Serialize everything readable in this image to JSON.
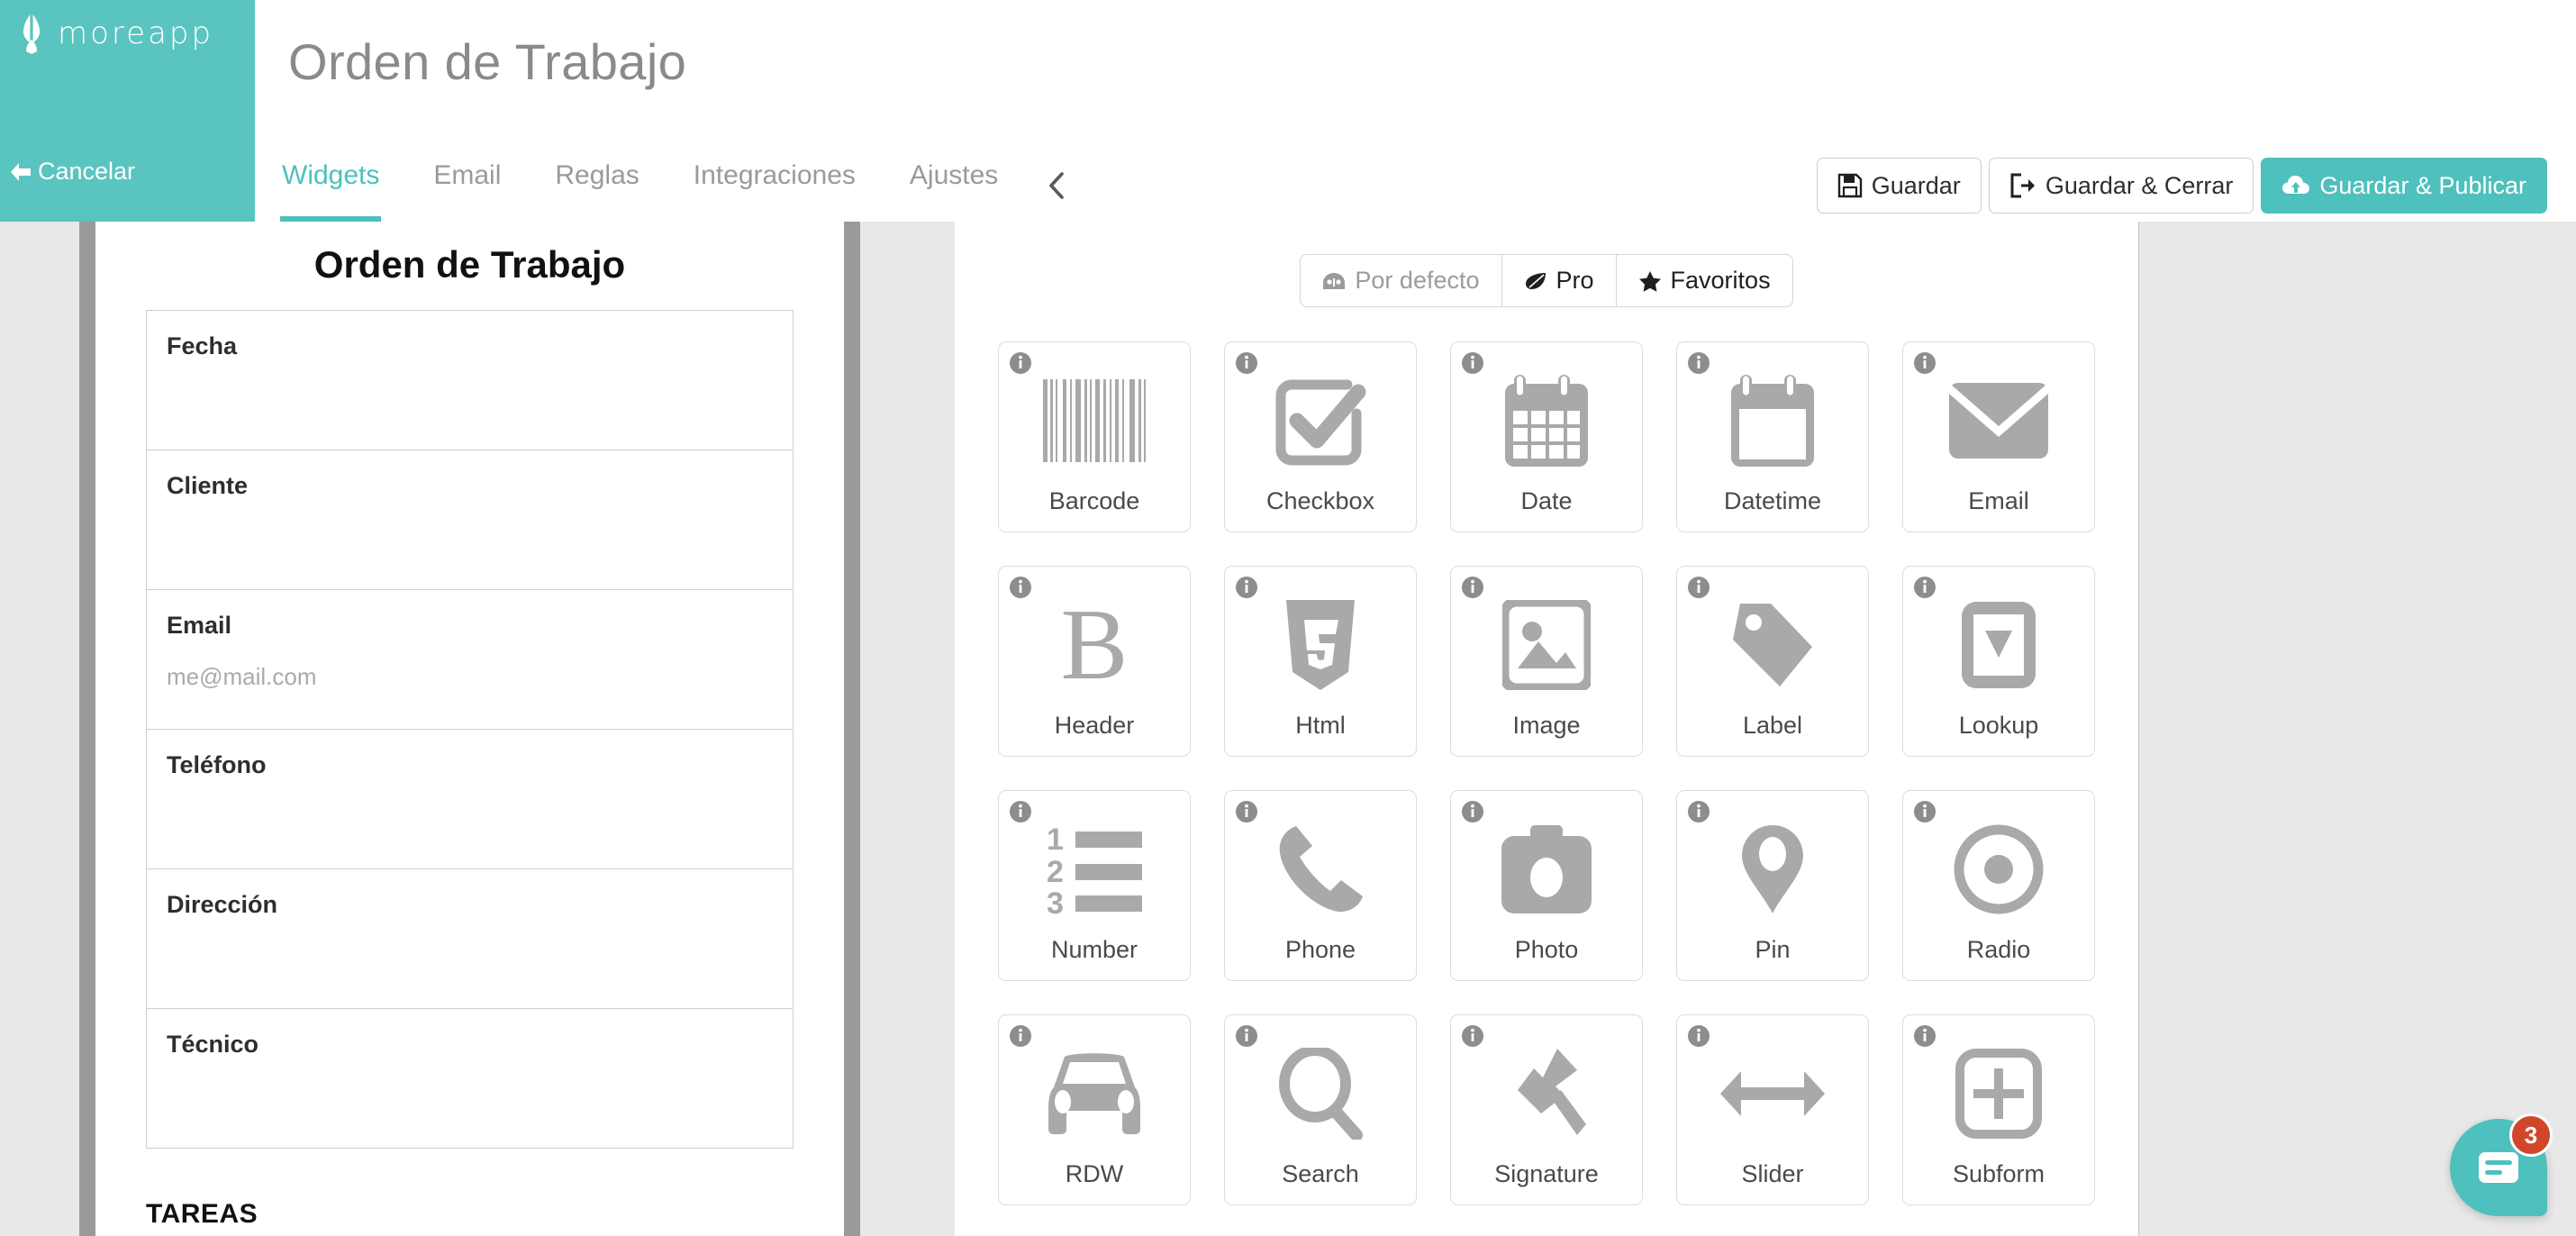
{
  "brand": {
    "name": "moreapp",
    "logo_icon": "leaf-icon",
    "color": "#5ac4c0"
  },
  "header": {
    "cancel_label": "Cancelar",
    "cancel_icon": "arrow-left-icon",
    "page_title": "Orden de Trabajo",
    "tabs": [
      {
        "label": "Widgets",
        "active": true
      },
      {
        "label": "Email",
        "active": false
      },
      {
        "label": "Reglas",
        "active": false
      },
      {
        "label": "Integraciones",
        "active": false
      },
      {
        "label": "Ajustes",
        "active": false
      }
    ],
    "collapse_icon": "chevron-left-icon",
    "actions": [
      {
        "label": "Guardar",
        "icon": "floppy-save-icon",
        "primary": false
      },
      {
        "label": "Guardar & Cerrar",
        "icon": "sign-out-icon",
        "primary": false
      },
      {
        "label": "Guardar & Publicar",
        "icon": "cloud-upload-icon",
        "primary": true
      }
    ],
    "accent_color": "#4ec0bd"
  },
  "preview": {
    "title": "Orden de Trabajo",
    "fields": [
      {
        "label": "Fecha",
        "placeholder": ""
      },
      {
        "label": "Cliente",
        "placeholder": ""
      },
      {
        "label": "Email",
        "placeholder": "me@mail.com"
      },
      {
        "label": "Teléfono",
        "placeholder": ""
      },
      {
        "label": "Dirección",
        "placeholder": ""
      },
      {
        "label": "Técnico",
        "placeholder": ""
      }
    ],
    "section_title": "TAREAS"
  },
  "widgets_panel": {
    "filters": [
      {
        "label": "Por defecto",
        "icon": "dashboard-icon",
        "selected": false
      },
      {
        "label": "Pro",
        "icon": "leaf-icon",
        "selected": true
      },
      {
        "label": "Favoritos",
        "icon": "star-icon",
        "selected": true
      }
    ],
    "info_icon": "info-icon",
    "widgets": [
      {
        "label": "Barcode",
        "icon": "barcode-icon"
      },
      {
        "label": "Checkbox",
        "icon": "checkbox-icon"
      },
      {
        "label": "Date",
        "icon": "calendar-icon"
      },
      {
        "label": "Datetime",
        "icon": "calendar-blank-icon"
      },
      {
        "label": "Email",
        "icon": "envelope-icon"
      },
      {
        "label": "Header",
        "icon": "bold-b-icon"
      },
      {
        "label": "Html",
        "icon": "html5-icon"
      },
      {
        "label": "Image",
        "icon": "image-icon"
      },
      {
        "label": "Label",
        "icon": "tag-icon"
      },
      {
        "label": "Lookup",
        "icon": "dropdown-icon"
      },
      {
        "label": "Number",
        "icon": "ordered-list-icon"
      },
      {
        "label": "Phone",
        "icon": "phone-icon"
      },
      {
        "label": "Photo",
        "icon": "camera-icon"
      },
      {
        "label": "Pin",
        "icon": "map-pin-icon"
      },
      {
        "label": "Radio",
        "icon": "radio-circle-icon"
      },
      {
        "label": "RDW",
        "icon": "car-icon"
      },
      {
        "label": "Search",
        "icon": "magnifier-icon"
      },
      {
        "label": "Signature",
        "icon": "signature-pen-icon"
      },
      {
        "label": "Slider",
        "icon": "arrows-horizontal-icon"
      },
      {
        "label": "Subform",
        "icon": "plus-box-icon"
      }
    ]
  },
  "chat": {
    "badge_count": "3",
    "icon": "chat-lines-icon",
    "color": "#4ec0bd",
    "badge_color": "#d1462a"
  }
}
